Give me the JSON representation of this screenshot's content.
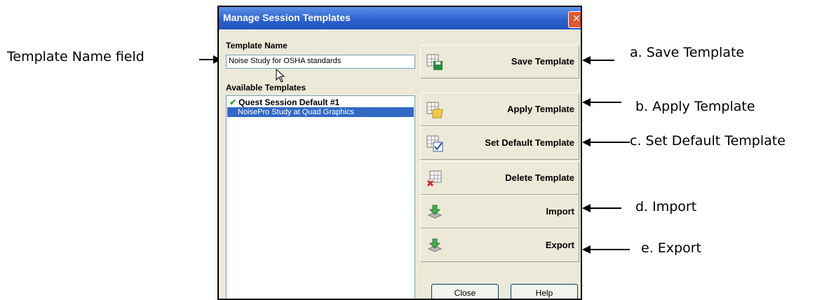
{
  "dialog": {
    "title": "Manage Session Templates",
    "close_glyph": "✕",
    "template_name_label": "Template Name",
    "template_name_value": "Noise Study for OSHA standards",
    "available_label": "Available Templates",
    "templates": [
      {
        "name": "Quest Session Default #1",
        "is_default": true,
        "selected": false
      },
      {
        "name": "NoisePro Study at Quad Graphics",
        "is_default": false,
        "selected": true
      }
    ],
    "buttons": {
      "save": "Save Template",
      "apply": "Apply Template",
      "set_default": "Set Default Template",
      "delete": "Delete Template",
      "import": "Import",
      "export": "Export"
    },
    "close_label": "Close",
    "help_label": "Help"
  },
  "annotations": {
    "template_name_field": "Template Name field",
    "save": "a. Save Template",
    "apply": "b. Apply Template",
    "set_default": "c. Set Default Template",
    "import": "d. Import",
    "export": "e. Export"
  },
  "icons": {
    "save": "save-template-icon",
    "apply": "apply-template-icon",
    "set_default": "set-default-template-icon",
    "delete": "delete-template-icon",
    "import": "import-icon",
    "export": "export-icon"
  },
  "colors": {
    "title_bar": "#2a5fcf",
    "selection": "#316ac5",
    "dialog_bg": "#ece9d8"
  }
}
